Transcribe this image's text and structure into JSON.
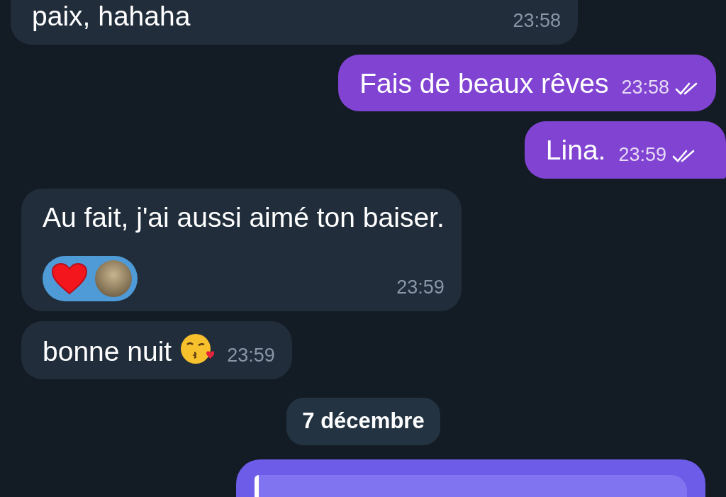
{
  "messages": [
    {
      "kind": "message",
      "outgoing": false,
      "text": "paix, hahaha",
      "time": "23:58",
      "wide": true
    },
    {
      "kind": "message",
      "outgoing": true,
      "text": "Fais de beaux rêves",
      "time": "23:58",
      "read": true
    },
    {
      "kind": "message",
      "outgoing": true,
      "text": "Lina.",
      "time": "23:59",
      "read": true,
      "tail": true
    },
    {
      "kind": "message",
      "outgoing": false,
      "text": "Au fait, j'ai aussi aimé ton baiser.",
      "time": "23:59",
      "reactions": [
        {
          "kind": "heart",
          "selected": true
        }
      ],
      "reacted_by_avatar": true
    },
    {
      "kind": "message",
      "outgoing": false,
      "text": "bonne nuit",
      "kiss_emoji": true,
      "time": "23:59"
    },
    {
      "kind": "date",
      "text": "7 décembre"
    },
    {
      "kind": "reply",
      "outgoing": true
    }
  ]
}
